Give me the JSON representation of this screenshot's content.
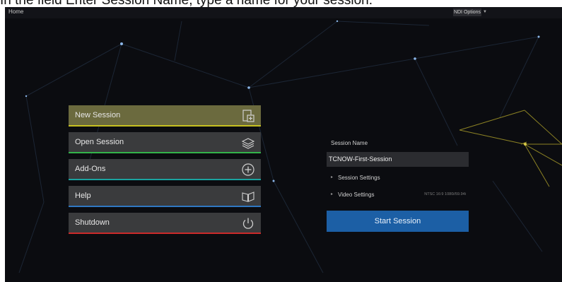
{
  "caption": "In the field Enter Session Name, type a name for your session.",
  "topbar": {
    "home": "Home",
    "ndi_options": "NDI Options",
    "ndi_arrow": "▼"
  },
  "menu": {
    "new_session": "New Session",
    "open_session": "Open Session",
    "add_ons": "Add-Ons",
    "help": "Help",
    "shutdown": "Shutdown"
  },
  "colors": {
    "new_session_bar": "#c6c020",
    "open_session_bar": "#33b34a",
    "add_ons_bar": "#1aa3a0",
    "help_bar": "#2f77c2",
    "shutdown_bar": "#cc2a2a",
    "start_button": "#1c5fa5"
  },
  "icons": {
    "new_session": "new-document-icon",
    "open_session": "layers-icon",
    "add_ons": "plus-circle-icon",
    "help": "open-book-icon",
    "shutdown": "power-icon"
  },
  "session": {
    "name_label": "Session Name",
    "name_value": "TCNOW-First-Session",
    "session_settings": "Session Settings",
    "video_settings": "Video Settings",
    "video_hint": "NTSC 16:9 1080i/59.94i",
    "expand_icon": "▸",
    "start_button": "Start Session"
  }
}
